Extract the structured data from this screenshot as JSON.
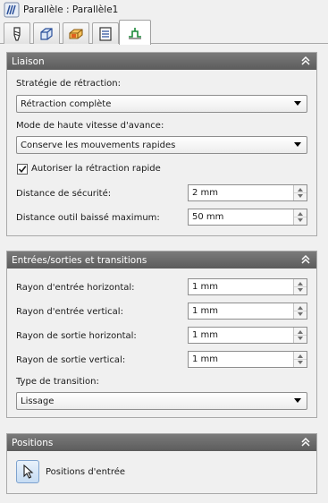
{
  "window": {
    "title": "Parallèle : Parallèle1",
    "app_icon": "parallel-toolpath-icon"
  },
  "tabs": [
    {
      "icon": "tool-icon",
      "active": false
    },
    {
      "icon": "stock-box-icon",
      "active": false
    },
    {
      "icon": "workpiece-icon",
      "active": false
    },
    {
      "icon": "parameters-list-icon",
      "active": false
    },
    {
      "icon": "linking-icon",
      "active": true
    }
  ],
  "liaison": {
    "title": "Liaison",
    "strategy_label": "Stratégie de rétraction:",
    "strategy_value": "Rétraction complète",
    "hsm_label": "Mode de haute vitesse d'avance:",
    "hsm_value": "Conserve les mouvements rapides",
    "rapid_retract_label": "Autoriser la rétraction rapide",
    "rapid_retract_checked": true,
    "safe_distance_label": "Distance de sécurité:",
    "safe_distance_value": "2 mm",
    "max_stay_down_label": "Distance outil baissé maximum:",
    "max_stay_down_value": "50 mm"
  },
  "leads": {
    "title": "Entrées/sorties et transitions",
    "rows": [
      {
        "label": "Rayon d'entrée horizontal:",
        "value": "1 mm"
      },
      {
        "label": "Rayon d'entrée vertical:",
        "value": "1 mm"
      },
      {
        "label": "Rayon de sortie horizontal:",
        "value": "1 mm"
      },
      {
        "label": "Rayon de sortie vertical:",
        "value": "1 mm"
      }
    ],
    "transition_label": "Type de transition:",
    "transition_value": "Lissage"
  },
  "positions": {
    "title": "Positions",
    "entry_label": "Positions d'entrée"
  },
  "colors": {
    "panel_header": "#6b6b6b",
    "pick_button": "#c6dcf3",
    "pick_border": "#7da2ce",
    "pointer_accent": "#1e5bb8"
  }
}
